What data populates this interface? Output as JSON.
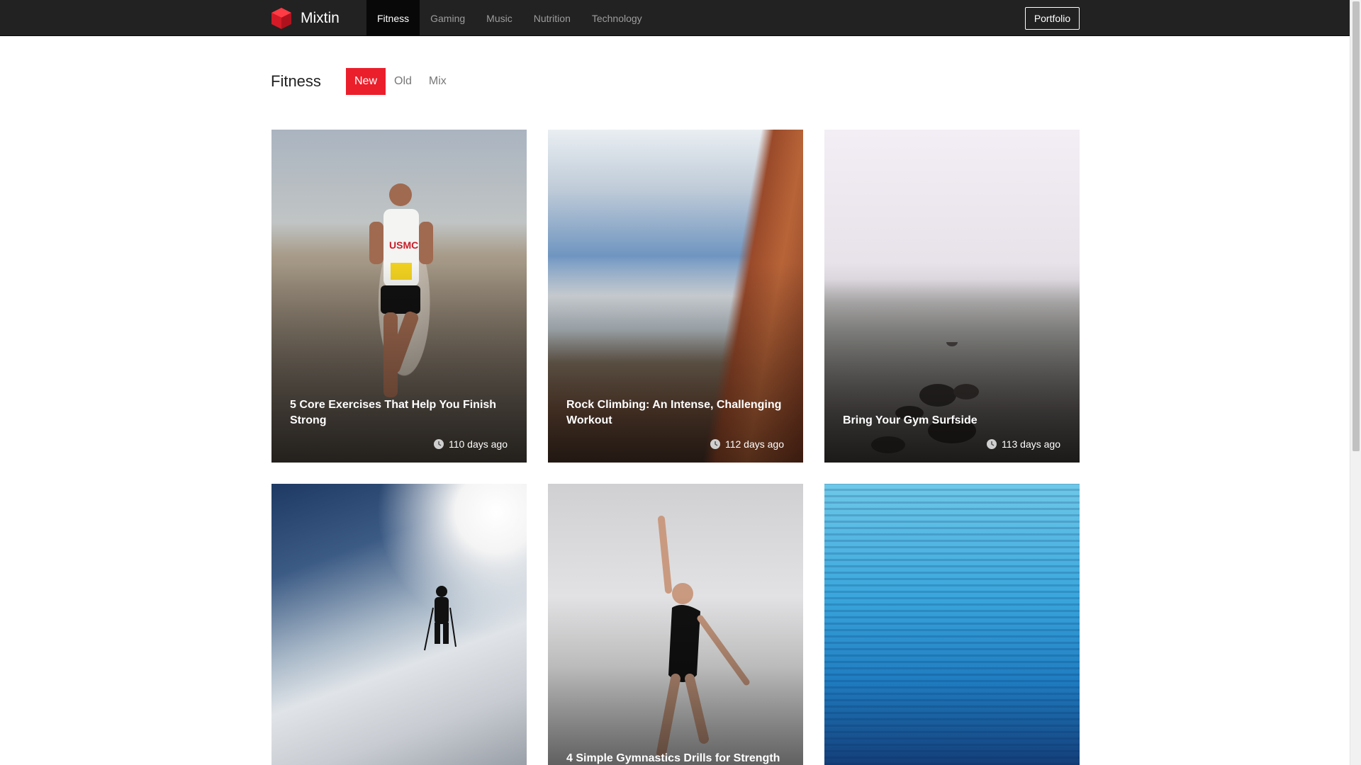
{
  "brand": {
    "name": "Mixtin",
    "icon": "cube-icon",
    "color": "#ea1f2b"
  },
  "nav": {
    "items": [
      {
        "label": "Fitness",
        "active": true
      },
      {
        "label": "Gaming",
        "active": false
      },
      {
        "label": "Music",
        "active": false
      },
      {
        "label": "Nutrition",
        "active": false
      },
      {
        "label": "Technology",
        "active": false
      }
    ],
    "portfolio_label": "Portfolio"
  },
  "section": {
    "title": "Fitness",
    "filters": [
      {
        "label": "New",
        "active": true
      },
      {
        "label": "Old",
        "active": false
      },
      {
        "label": "Mix",
        "active": false
      }
    ]
  },
  "cards": [
    {
      "title": "5 Core Exercises That Help You Finish Strong",
      "age": "110 days ago",
      "image": "runner"
    },
    {
      "title": "Rock Climbing: An Intense, Challenging Workout",
      "age": "112 days ago",
      "image": "red-rock-cliff"
    },
    {
      "title": "Bring Your Gym Surfside",
      "age": "113 days ago",
      "image": "rocky-beach"
    },
    {
      "title": "",
      "age": "",
      "image": "skier-on-slope"
    },
    {
      "title": "4 Simple Gymnastics Drills for Strength",
      "age": "",
      "image": "dancer"
    },
    {
      "title": "",
      "age": "",
      "image": "swimming-pool-water"
    }
  ],
  "colors": {
    "accent": "#ea1f2b",
    "navbar": "#222222"
  }
}
